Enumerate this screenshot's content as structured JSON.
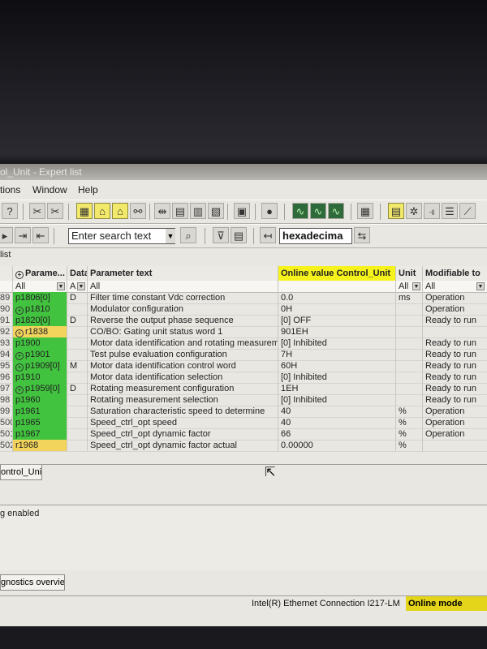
{
  "window": {
    "title": "ol_Unit - Expert list"
  },
  "menu": {
    "items": [
      "tions",
      "Window",
      "Help"
    ]
  },
  "toolbar": {
    "search_placeholder": "Enter search text",
    "number_format": "hexadecima"
  },
  "list_label": "list",
  "table": {
    "headers": {
      "parameter": "Parame...",
      "data": "Data",
      "text": "Parameter text",
      "online_value": "Online value Control_Unit",
      "unit": "Unit",
      "modifiable": "Modifiable to"
    },
    "filters": {
      "parameter": "All",
      "data": "A",
      "text": "All",
      "unit": "All",
      "modifiable": "All"
    },
    "rows": [
      {
        "num": "89",
        "param": "p1806[0]",
        "data": "D",
        "text": "Filter time constant Vdc correction",
        "value": "0.0",
        "unit": "ms",
        "mod": "Operation",
        "color": "green",
        "expand": false
      },
      {
        "num": "90",
        "param": "p1810",
        "data": "",
        "text": "Modulator configuration",
        "value": "0H",
        "unit": "",
        "mod": "Operation",
        "color": "green",
        "expand": true
      },
      {
        "num": "91",
        "param": "p1820[0]",
        "data": "D",
        "text": "Reverse the output phase sequence",
        "value": "[0] OFF",
        "unit": "",
        "mod": "Ready to run",
        "color": "green",
        "expand": false
      },
      {
        "num": "92",
        "param": "r1838",
        "data": "",
        "text": "CO/BO: Gating unit status word 1",
        "value": "901EH",
        "unit": "",
        "mod": "",
        "color": "yellow",
        "expand": true
      },
      {
        "num": "93",
        "param": "p1900",
        "data": "",
        "text": "Motor data identification and rotating measurement",
        "value": "[0] Inhibited",
        "unit": "",
        "mod": "Ready to run",
        "color": "green",
        "expand": false
      },
      {
        "num": "94",
        "param": "p1901",
        "data": "",
        "text": "Test pulse evaluation configuration",
        "value": "7H",
        "unit": "",
        "mod": "Ready to run",
        "color": "green",
        "expand": true
      },
      {
        "num": "95",
        "param": "p1909[0]",
        "data": "M",
        "text": "Motor data identification control word",
        "value": "60H",
        "unit": "",
        "mod": "Ready to run",
        "color": "green",
        "expand": true
      },
      {
        "num": "96",
        "param": "p1910",
        "data": "",
        "text": "Motor data identification selection",
        "value": "[0] Inhibited",
        "unit": "",
        "mod": "Ready to run",
        "color": "green",
        "expand": false
      },
      {
        "num": "97",
        "param": "p1959[0]",
        "data": "D",
        "text": "Rotating measurement configuration",
        "value": "1EH",
        "unit": "",
        "mod": "Ready to run",
        "color": "green",
        "expand": true
      },
      {
        "num": "98",
        "param": "p1960",
        "data": "",
        "text": "Rotating measurement selection",
        "value": "[0] Inhibited",
        "unit": "",
        "mod": "Ready to run",
        "color": "green",
        "expand": false
      },
      {
        "num": "99",
        "param": "p1961",
        "data": "",
        "text": "Saturation characteristic speed to determine",
        "value": "40",
        "unit": "%",
        "mod": "Operation",
        "color": "green",
        "expand": false
      },
      {
        "num": "500",
        "param": "p1965",
        "data": "",
        "text": "Speed_ctrl_opt speed",
        "value": "40",
        "unit": "%",
        "mod": "Operation",
        "color": "green",
        "expand": false
      },
      {
        "num": "501",
        "param": "p1967",
        "data": "",
        "text": "Speed_ctrl_opt dynamic factor",
        "value": "66",
        "unit": "%",
        "mod": "Operation",
        "color": "green",
        "expand": false
      },
      {
        "num": "502",
        "param": "r1968",
        "data": "",
        "text": "Speed_ctrl_opt dynamic factor actual",
        "value": "0.00000",
        "unit": "%",
        "mod": "",
        "color": "yellow",
        "expand": false
      }
    ]
  },
  "tabs": {
    "control_unit": "ontrol_Unit"
  },
  "log": {
    "line": "g enabled"
  },
  "bottom_tab": "gnostics overview",
  "status": {
    "connection": "Intel(R) Ethernet Connection I217-LM",
    "mode": "Online mode"
  },
  "colors": {
    "editable_param": "#42c33f",
    "readonly_param": "#f2d35c",
    "online_header": "#f6f21c",
    "online_mode": "#e4d51a"
  }
}
